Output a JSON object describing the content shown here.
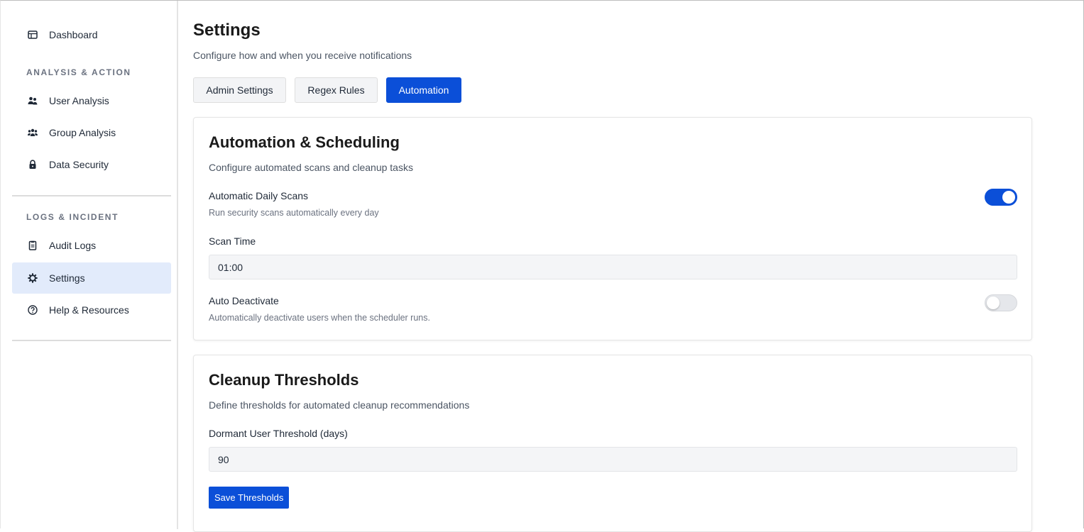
{
  "sidebar": {
    "items": [
      {
        "label": "Dashboard",
        "icon": "dashboard-icon"
      },
      {
        "label": "User Analysis",
        "icon": "users-icon"
      },
      {
        "label": "Group Analysis",
        "icon": "group-icon"
      },
      {
        "label": "Data Security",
        "icon": "lock-icon"
      },
      {
        "label": "Audit Logs",
        "icon": "clipboard-icon"
      },
      {
        "label": "Settings",
        "icon": "gear-icon",
        "active": true
      },
      {
        "label": "Help & Resources",
        "icon": "help-circle-icon"
      }
    ],
    "sections": {
      "analysis": "ANALYSIS & ACTION",
      "logs": "LOGS & INCIDENT"
    }
  },
  "header": {
    "title": "Settings",
    "subtitle": "Configure how and when you receive notifications"
  },
  "tabs": [
    {
      "label": "Admin Settings"
    },
    {
      "label": "Regex Rules"
    },
    {
      "label": "Automation",
      "active": true
    }
  ],
  "automation": {
    "title": "Automation & Scheduling",
    "subtitle": "Configure automated scans and cleanup tasks",
    "daily_scans": {
      "label": "Automatic Daily Scans",
      "hint": "Run security scans automatically every day",
      "enabled": true
    },
    "scan_time": {
      "label": "Scan Time",
      "value": "01:00"
    },
    "auto_deactivate": {
      "label": "Auto Deactivate",
      "hint": "Automatically deactivate users when the scheduler runs.",
      "enabled": false
    }
  },
  "cleanup": {
    "title": "Cleanup Thresholds",
    "subtitle": "Define thresholds for automated cleanup recommendations",
    "dormant": {
      "label": "Dormant User Threshold (days)",
      "value": "90"
    },
    "save_label": "Save Thresholds"
  },
  "colors": {
    "accent": "#0b4fd8",
    "active_nav_bg": "#e2ebfb"
  }
}
